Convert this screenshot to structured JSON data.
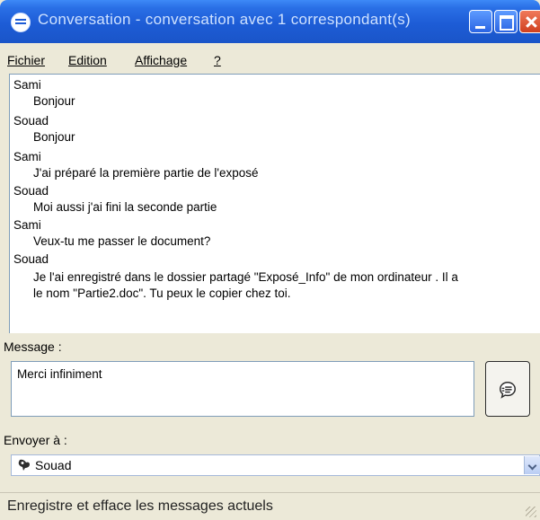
{
  "window": {
    "title": "Conversation - conversation avec 1 correspondant(s)",
    "icon": "chat-bubble-icon"
  },
  "menu": [
    {
      "label": "Fichier"
    },
    {
      "label": "Edition"
    },
    {
      "label": "Affichage"
    },
    {
      "label": "?"
    }
  ],
  "conversation": [
    {
      "sender": "Sami",
      "lines": [
        "Bonjour"
      ]
    },
    {
      "sender": "Souad",
      "lines": [
        "Bonjour"
      ]
    },
    {
      "sender": "Sami",
      "lines": [
        "J'ai préparé la première partie de l'exposé"
      ]
    },
    {
      "sender": "Souad",
      "lines": [
        "Moi aussi j'ai fini la seconde partie"
      ]
    },
    {
      "sender": "Sami",
      "lines": [
        "Veux-tu me passer le document?"
      ]
    },
    {
      "sender": "Souad",
      "lines": [
        "Je l'ai enregistré dans le dossier partagé \"Exposé_Info\" de mon ordinateur . Il a",
        "le nom \"Partie2.doc\". Tu peux le copier chez toi."
      ]
    }
  ],
  "message": {
    "label": "Message :",
    "value": "Merci infiniment"
  },
  "send_to": {
    "label": "Envoyer à :",
    "selected": "Souad"
  },
  "status": {
    "text": "Enregistre et efface les messages actuels"
  },
  "colors": {
    "titlebar": "#1d5cd6",
    "window_bg": "#ece9d8",
    "field_border": "#7f9db9"
  }
}
